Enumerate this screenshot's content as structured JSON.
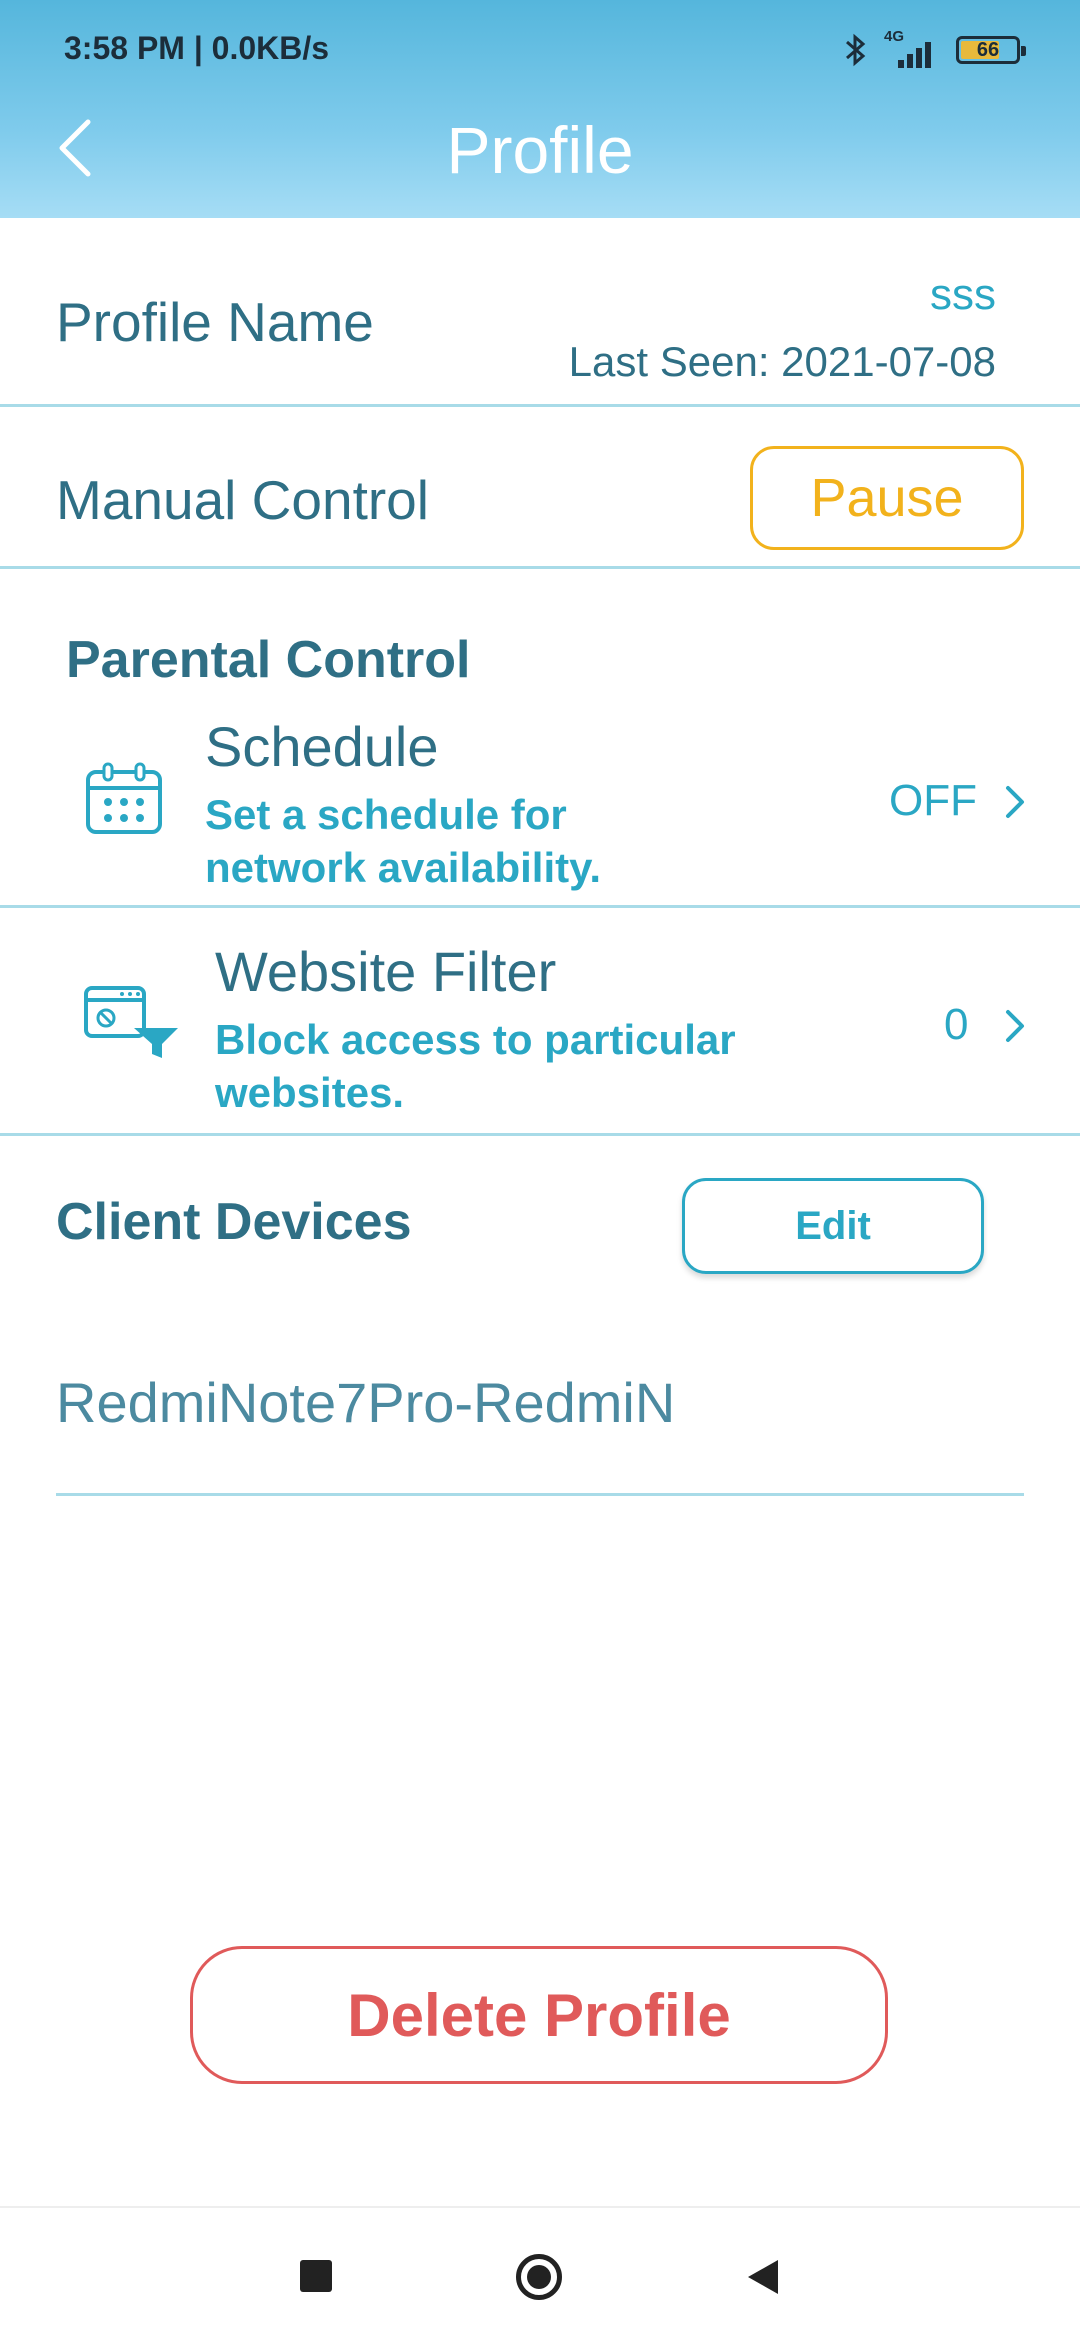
{
  "status_bar": {
    "time": "3:58 PM | 0.0KB/s",
    "network": "4G",
    "battery": "66"
  },
  "header": {
    "title": "Profile"
  },
  "profile": {
    "label": "Profile Name",
    "value": "sss",
    "last_seen": "Last Seen: 2021-07-08"
  },
  "manual_control": {
    "label": "Manual Control",
    "button": "Pause"
  },
  "parental_control": {
    "title": "Parental Control",
    "schedule": {
      "title": "Schedule",
      "subtitle_line1": "Set a schedule for",
      "subtitle_line2": "network availability.",
      "value": "OFF"
    },
    "website_filter": {
      "title": "Website Filter",
      "subtitle_line1": "Block access to particular",
      "subtitle_line2": "websites.",
      "value": "0"
    }
  },
  "client_devices": {
    "title": "Client Devices",
    "edit_label": "Edit",
    "devices": [
      "RedmiNote7Pro-RedmiN"
    ]
  },
  "actions": {
    "delete_label": "Delete Profile"
  },
  "colors": {
    "accent": "#2aa7c4",
    "text": "#2f6f85",
    "pause": "#f2b21c",
    "delete": "#e05a5a"
  }
}
